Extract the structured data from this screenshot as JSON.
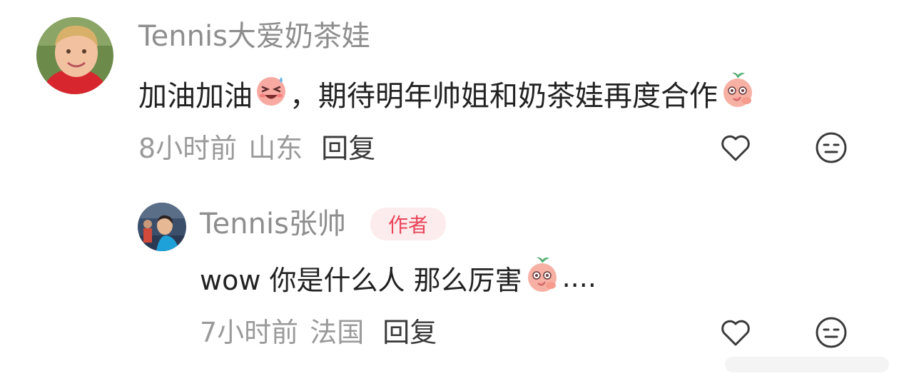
{
  "comments": [
    {
      "username": "Tennis大爱奶茶娃",
      "text_part1": "加油加油",
      "text_part2": "，期待明年帅姐和奶茶娃再度合作",
      "time": "8小时前",
      "location": "山东",
      "reply_label": "回复"
    },
    {
      "username": "Tennis张帅",
      "badge": "作者",
      "text_part1": "wow 你是什么人 那么厉害",
      "text_part2": "....",
      "time": "7小时前",
      "location": "法国",
      "reply_label": "回复"
    }
  ],
  "icons": {
    "like": "heart-icon",
    "emoji": "neutral-face-icon",
    "emoji_laugh": "laughing-emoji",
    "emoji_shy": "peach-shy-emoji"
  },
  "colors": {
    "username": "#8e8e8e",
    "badge_text": "#e8445a",
    "badge_bg": "#fdeced"
  }
}
